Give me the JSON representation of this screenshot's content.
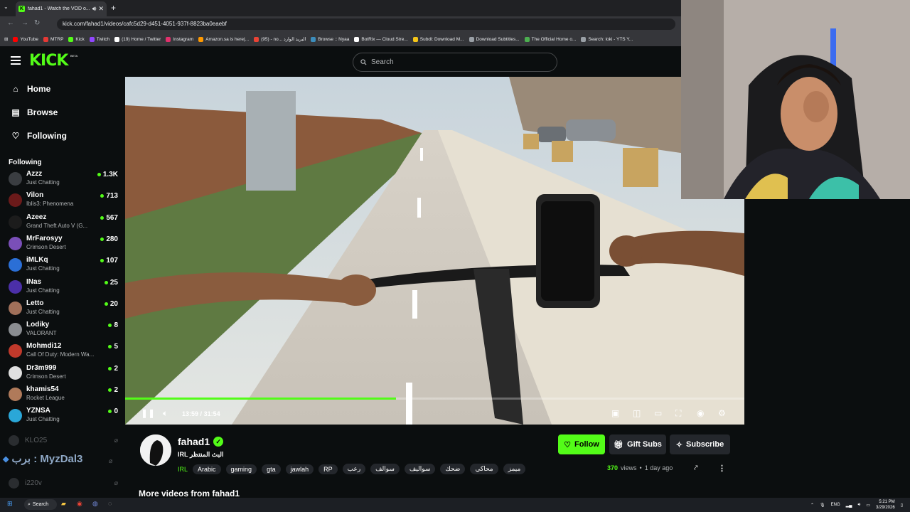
{
  "browser": {
    "tab_title": "fahad1 - Watch the VOD o...",
    "url": "kick.com/fahad1/videos/cafc5d29-d451-4051-937f-8823ba0eaebf",
    "bookmarks": [
      {
        "label": "YouTube",
        "color": "#ff0000"
      },
      {
        "label": "MTRP",
        "color": "#e53935"
      },
      {
        "label": "Kick",
        "color": "#53fc18"
      },
      {
        "label": "Twitch",
        "color": "#9146ff"
      },
      {
        "label": "(19) Home / Twitter",
        "color": "#ffffff"
      },
      {
        "label": "Instagram",
        "color": "#e1306c"
      },
      {
        "label": "Amazon.sa is here|...",
        "color": "#ff9900"
      },
      {
        "label": "(95) - no... البريد الوارد",
        "color": "#ea4335"
      },
      {
        "label": "Browse :: Nyaa",
        "color": "#3c8dbc"
      },
      {
        "label": "BotRix — Cloud Stre...",
        "color": "#ffffff"
      },
      {
        "label": "Subdl: Download M...",
        "color": "#f5c518"
      },
      {
        "label": "Download Subtitles...",
        "color": "#9aa0a6"
      },
      {
        "label": "The Official Home o...",
        "color": "#4caf50"
      },
      {
        "label": "Search: loki - YTS Y...",
        "color": "#9aa0a6"
      }
    ]
  },
  "header": {
    "logo": "KICK",
    "logo_badge": "BETA",
    "search_placeholder": "Search"
  },
  "sidebar": {
    "nav": [
      {
        "label": "Home",
        "icon": "home-icon"
      },
      {
        "label": "Browse",
        "icon": "browse-icon"
      },
      {
        "label": "Following",
        "icon": "heart-icon"
      }
    ],
    "following_header": "Following",
    "channels": [
      {
        "name": "Azzz",
        "category": "Just Chatting",
        "viewers": "1.3K",
        "color": "#3a3d41"
      },
      {
        "name": "Vilon",
        "category": "Iblis3: Phenomena",
        "viewers": "713",
        "color": "#6b1a1a"
      },
      {
        "name": "Azeez",
        "category": "Grand Theft Auto V (G...",
        "viewers": "567",
        "color": "#1c1c1c"
      },
      {
        "name": "MrFarosyy",
        "category": "Crimson Desert",
        "viewers": "280",
        "color": "#7a4fb8"
      },
      {
        "name": "iMLKq",
        "category": "Just Chatting",
        "viewers": "107",
        "color": "#2b6fd6"
      },
      {
        "name": "INas",
        "category": "Just Chatting",
        "viewers": "25",
        "color": "#4b2fa8"
      },
      {
        "name": "Letto",
        "category": "Just Chatting",
        "viewers": "20",
        "color": "#a0705a"
      },
      {
        "name": "Lodiky",
        "category": "VALORANT",
        "viewers": "8",
        "color": "#8a8d91"
      },
      {
        "name": "Mohmdi12",
        "category": "Call Of Duty: Modern Wa...",
        "viewers": "5",
        "color": "#c0392b"
      },
      {
        "name": "Dr3m999",
        "category": "Crimson Desert",
        "viewers": "2",
        "color": "#e0e0e0"
      },
      {
        "name": "khamis54",
        "category": "Rocket League",
        "viewers": "2",
        "color": "#b07a5a"
      },
      {
        "name": "YZNSA",
        "category": "Just Chatting",
        "viewers": "0",
        "color": "#2aa7d8"
      }
    ],
    "offline": [
      {
        "name": "KLO25"
      },
      {
        "name": "برب : MyzDal3"
      },
      {
        "name": "i220v"
      }
    ]
  },
  "player": {
    "current_time": "13:59",
    "duration": "31:54",
    "progress_fraction": 0.438
  },
  "video_info": {
    "channel": "fahad1",
    "title": "البث المنتظر IRL",
    "category": "IRL",
    "tags": [
      "Arabic",
      "gaming",
      "gta",
      "jawlah",
      "RP",
      "رعب",
      "سوالف",
      "سواليف",
      "ضحك",
      "محاكي",
      "ميمز"
    ],
    "follow_label": "Follow",
    "gift_label": "Gift Subs",
    "subscribe_label": "Subscribe",
    "views": "370",
    "views_suffix": "views",
    "separator": "•",
    "age": "1 day ago",
    "more_videos": "More videos from fahad1"
  },
  "taskbar": {
    "search_label": "Search",
    "lang": "ENG",
    "time": "5:21 PM",
    "date": "3/29/2026"
  },
  "colors": {
    "accent": "#53fc18",
    "background": "#0b0e0f",
    "button_dark": "#24272c"
  }
}
